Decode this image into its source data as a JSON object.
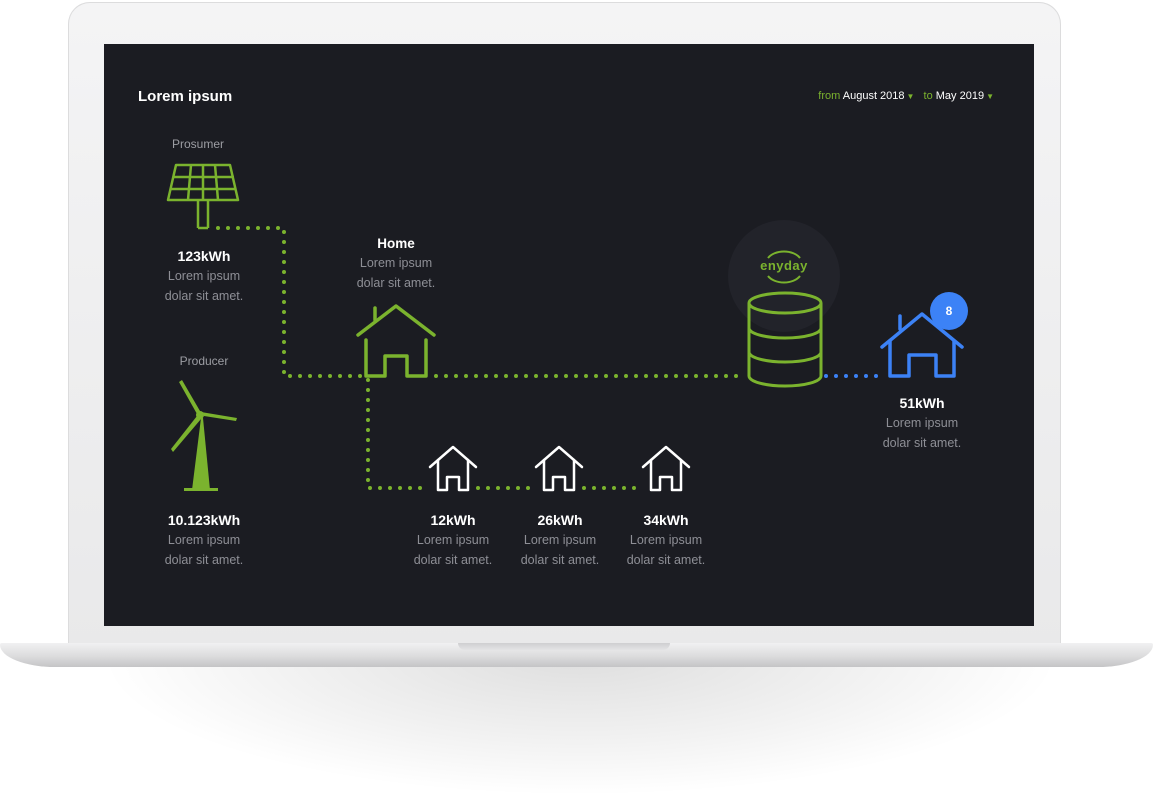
{
  "header": {
    "title": "Lorem ipsum",
    "range": {
      "from_label": "from",
      "from_value": "August 2018",
      "to_label": "to",
      "to_value": "May 2019",
      "caret_icon": "caret-down-icon"
    }
  },
  "colors": {
    "background": "#1b1c22",
    "accent_green": "#7bb32e",
    "accent_blue": "#3c82f6",
    "text_white": "#ffffff",
    "text_muted": "#8e8f96"
  },
  "nodes": {
    "prosumer": {
      "heading": "Prosumer",
      "value": "123kWh",
      "desc1": "Lorem ipsum",
      "desc2": "dolar sit amet.",
      "icon": "solar-panel-icon"
    },
    "producer": {
      "heading": "Producer",
      "value": "10.123kWh",
      "desc1": "Lorem ipsum",
      "desc2": "dolar sit amet.",
      "icon": "wind-turbine-icon"
    },
    "home": {
      "name": "Home",
      "desc1": "Lorem ipsum",
      "desc2": "dolar sit amet.",
      "icon": "house-icon"
    },
    "houses": [
      {
        "value": "12kWh",
        "desc1": "Lorem ipsum",
        "desc2": "dolar sit amet.",
        "icon": "house-icon"
      },
      {
        "value": "26kWh",
        "desc1": "Lorem ipsum",
        "desc2": "dolar sit amet.",
        "icon": "house-icon"
      },
      {
        "value": "34kWh",
        "desc1": "Lorem ipsum",
        "desc2": "dolar sit amet.",
        "icon": "house-icon"
      }
    ],
    "storage": {
      "brand": "enyday",
      "icon": "database-icon"
    },
    "consumer": {
      "value": "51kWh",
      "desc1": "Lorem ipsum",
      "desc2": "dolar sit amet.",
      "badge": "8",
      "icon": "house-icon"
    }
  }
}
